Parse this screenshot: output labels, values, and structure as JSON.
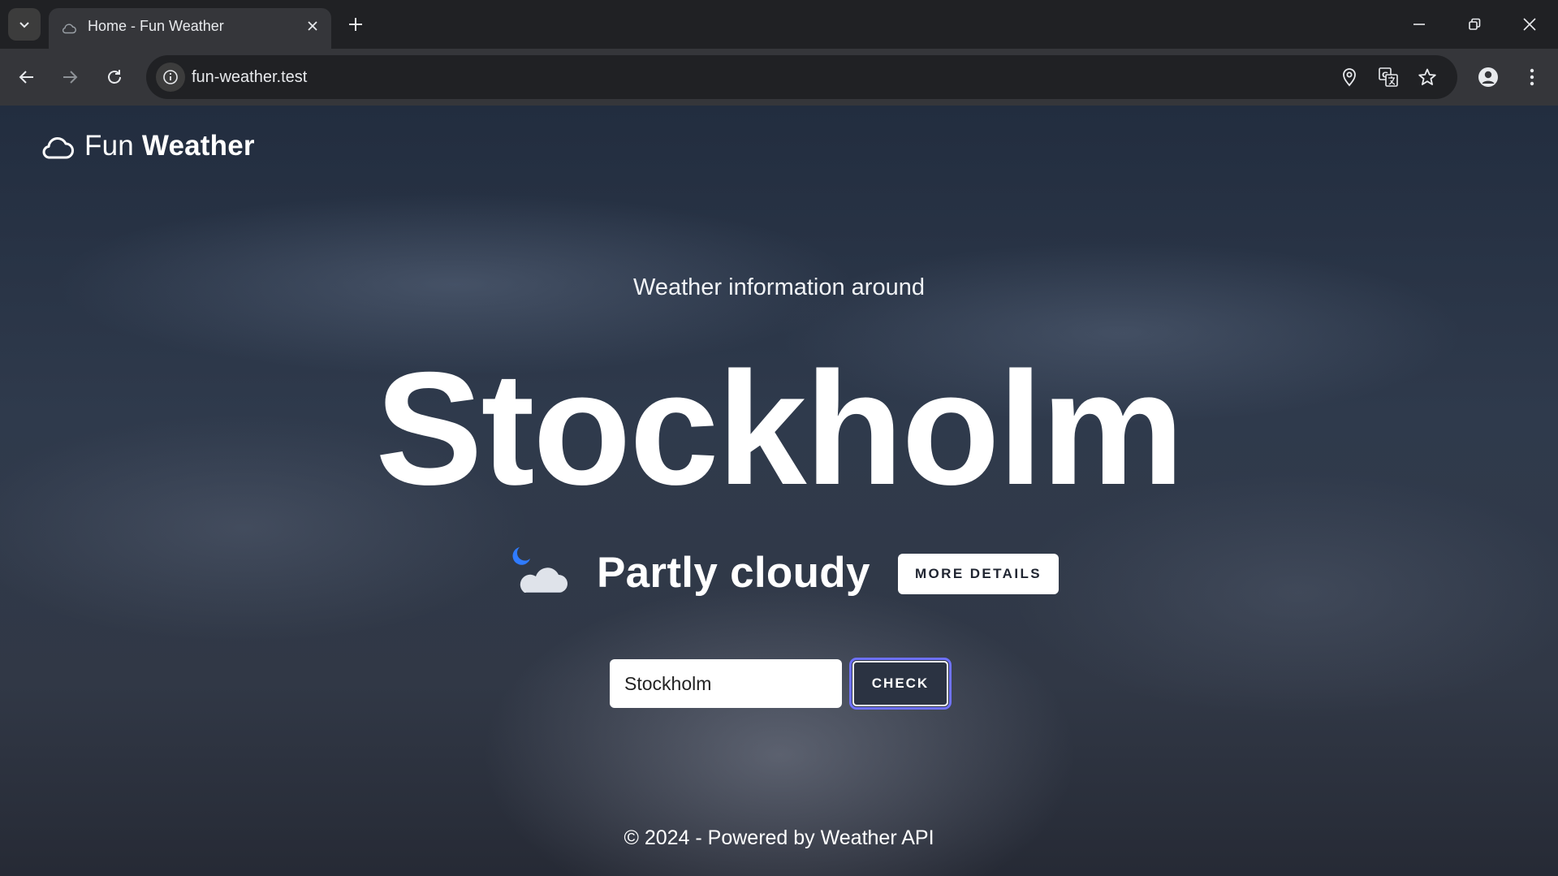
{
  "browser": {
    "tab": {
      "title": "Home - Fun Weather"
    },
    "address_bar": {
      "url": "fun-weather.test"
    },
    "icons": {
      "tab_search": "chevron-down-icon",
      "tab_close": "close-icon",
      "new_tab": "plus-icon",
      "minimize": "minimize-icon",
      "restore": "restore-icon",
      "close_window": "close-icon",
      "back": "arrow-left-icon",
      "forward": "arrow-right-icon",
      "reload": "reload-icon",
      "site_info": "info-icon",
      "location": "location-pin-icon",
      "translate": "translate-icon",
      "bookmark": "star-icon",
      "profile": "person-icon",
      "menu": "kebab-menu-icon"
    }
  },
  "page": {
    "brand": {
      "light": "Fun",
      "bold": "Weather",
      "icon": "cloud-icon"
    },
    "subtitle": "Weather information around",
    "city": "Stockholm",
    "condition": {
      "text": "Partly cloudy",
      "icon": "partly-cloudy-night-icon"
    },
    "more_details_label": "MORE DETAILS",
    "search": {
      "value": "Stockholm"
    },
    "check_label": "CHECK",
    "footer": "© 2024 - Powered by Weather API"
  },
  "colors": {
    "chrome_dark": "#202124",
    "chrome_toolbar": "#35363a",
    "focus_ring": "#6f72ff",
    "moon": "#2f7bff"
  }
}
